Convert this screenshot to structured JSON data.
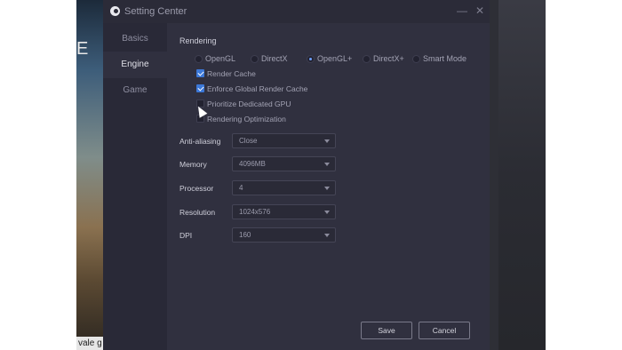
{
  "background": {
    "partial_letter": "E",
    "bottom_text": "vale g"
  },
  "window": {
    "title": "Setting Center",
    "controls": {
      "minimize": "—",
      "close": "✕"
    }
  },
  "sidebar": {
    "items": [
      {
        "label": "Basics",
        "active": false
      },
      {
        "label": "Engine",
        "active": true
      },
      {
        "label": "Game",
        "active": false
      }
    ]
  },
  "rendering": {
    "title": "Rendering",
    "modes": [
      {
        "label": "OpenGL",
        "selected": false
      },
      {
        "label": "DirectX",
        "selected": false
      },
      {
        "label": "OpenGL+",
        "selected": true
      },
      {
        "label": "DirectX+",
        "selected": false
      },
      {
        "label": "Smart Mode",
        "selected": false
      }
    ],
    "options": [
      {
        "label": "Render Cache",
        "checked": true
      },
      {
        "label": "Enforce Global Render Cache",
        "checked": true
      },
      {
        "label": "Prioritize Dedicated GPU",
        "checked": false
      },
      {
        "label": "Rendering Optimization",
        "checked": false
      }
    ]
  },
  "fields": [
    {
      "label": "Anti-aliasing",
      "value": "Close"
    },
    {
      "label": "Memory",
      "value": "4096MB"
    },
    {
      "label": "Processor",
      "value": "4"
    },
    {
      "label": "Resolution",
      "value": "1024x576"
    },
    {
      "label": "DPI",
      "value": "160"
    }
  ],
  "buttons": {
    "save": "Save",
    "cancel": "Cancel"
  },
  "colors": {
    "accent": "#3c78d8",
    "window_bg": "#30303f",
    "sidebar_bg": "#292937"
  }
}
